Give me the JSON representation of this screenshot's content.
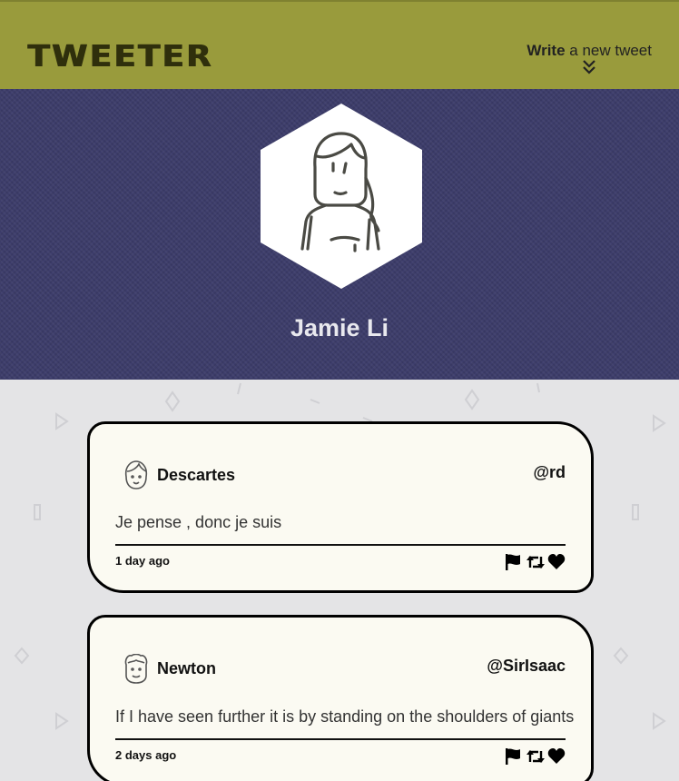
{
  "nav": {
    "brand": "TWEETER",
    "compose_bold": "Write",
    "compose_rest": " a new tweet"
  },
  "profile": {
    "name": "Jamie Li"
  },
  "tweets": [
    {
      "name": "Descartes",
      "handle": "@rd",
      "text": "Je pense , donc je suis",
      "time": "1 day ago"
    },
    {
      "name": "Newton",
      "handle": "@SirIsaac",
      "text": "If I have seen further it is by standing on the shoulders of giants",
      "time": "2 days ago"
    }
  ],
  "icons": {
    "compose": "chevron-double-down-icon",
    "flag": "flag-icon",
    "retweet": "retweet-icon",
    "like": "heart-icon"
  },
  "colors": {
    "nav_bg": "#999b3c",
    "profile_bg": "#3d3d6b",
    "feed_bg": "#e4e4e6",
    "card_bg": "#fbfaf2"
  }
}
